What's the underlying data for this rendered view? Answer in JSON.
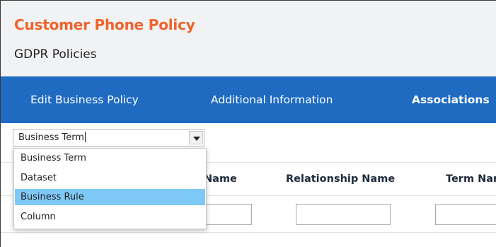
{
  "header": {
    "title": "Customer Phone Policy",
    "subtitle": "GDPR Policies",
    "title_color": "#f0632c",
    "background": "#f1f2f4"
  },
  "tabs": {
    "background": "#1f6bc2",
    "items": [
      {
        "label": "Edit Business Policy"
      },
      {
        "label": "Additional Information"
      },
      {
        "label": "Associations"
      }
    ]
  },
  "type_select": {
    "value": "Business Term",
    "options": [
      "Business Term",
      "Dataset",
      "Business Rule",
      "Column"
    ],
    "highlighted_option": "Business Rule",
    "highlight_color": "#7fc9f7"
  },
  "table": {
    "columns": [
      "er Name",
      "Relationship Name",
      "Term Nar"
    ]
  }
}
